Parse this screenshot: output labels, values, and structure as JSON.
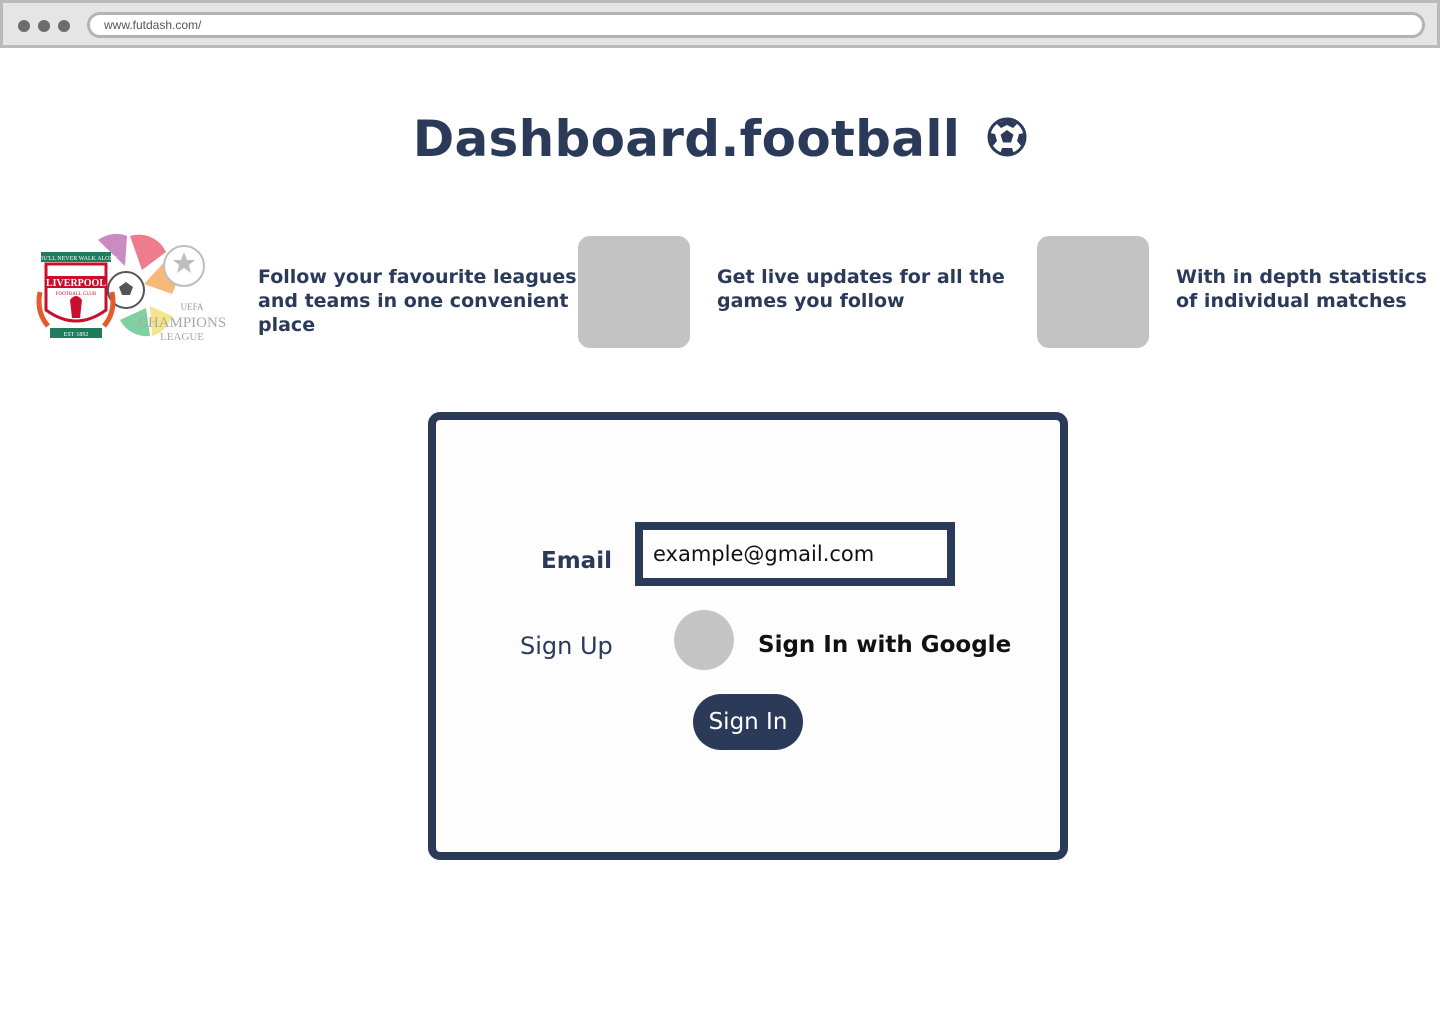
{
  "browser": {
    "url": "www.futdash.com/"
  },
  "header": {
    "title": "Dashboard.football",
    "title_icon": "soccer-ball-icon"
  },
  "logos": {
    "liverpool_banner": "YOU'LL NEVER WALK ALONE",
    "liverpool_name": "LIVERPOOL",
    "liverpool_sub": "FOOTBALL CLUB",
    "liverpool_est": "EST·1892",
    "ucl_uefa": "UEFA",
    "ucl_champions": "CHAMPIONS",
    "ucl_league": "LEAGUE"
  },
  "features": [
    {
      "text": "Follow your favourite leagues and teams in one convenient place"
    },
    {
      "text": "Get live updates for all the games you follow"
    },
    {
      "text": "With in depth statistics of individual matches"
    }
  ],
  "login": {
    "email_label": "Email",
    "email_value": "example@gmail.com",
    "signup_label": "Sign Up",
    "google_label": "Sign In with Google",
    "signin_label": "Sign In"
  },
  "colors": {
    "primary": "#2c3a5a",
    "placeholder_gray": "#c3c3c3",
    "chrome_gray": "#e5e5e5"
  }
}
